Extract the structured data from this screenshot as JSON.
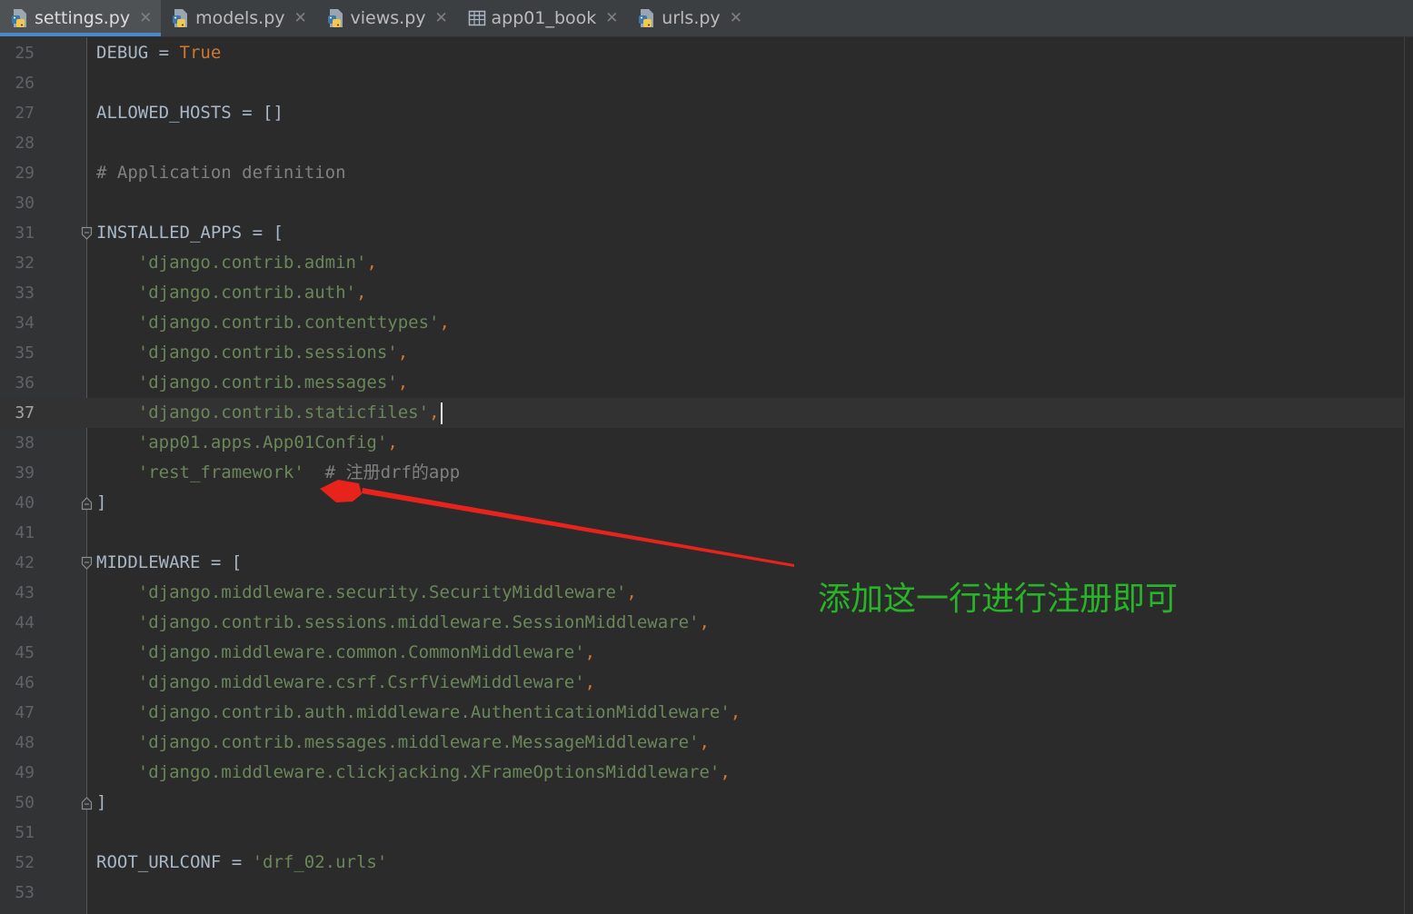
{
  "tabs": [
    {
      "label": "settings.py",
      "icon": "python-file-icon",
      "active": true
    },
    {
      "label": "models.py",
      "icon": "python-file-icon",
      "active": false
    },
    {
      "label": "views.py",
      "icon": "python-file-icon",
      "active": false
    },
    {
      "label": "app01_book",
      "icon": "table-icon",
      "active": false
    },
    {
      "label": "urls.py",
      "icon": "python-file-icon",
      "active": false
    }
  ],
  "tab_close_glyph": "✕",
  "current_line": "37",
  "lines": [
    {
      "n": "25",
      "parts": [
        {
          "t": "DEBUG = ",
          "c": "plain"
        },
        {
          "t": "True",
          "c": "kw"
        }
      ]
    },
    {
      "n": "26",
      "parts": []
    },
    {
      "n": "27",
      "parts": [
        {
          "t": "ALLOWED_HOSTS = []",
          "c": "plain"
        }
      ]
    },
    {
      "n": "28",
      "parts": []
    },
    {
      "n": "29",
      "parts": [
        {
          "t": "# Application definition",
          "c": "cmt"
        }
      ]
    },
    {
      "n": "30",
      "parts": []
    },
    {
      "n": "31",
      "parts": [
        {
          "t": "INSTALLED_APPS = [",
          "c": "plain"
        }
      ],
      "fold": "open"
    },
    {
      "n": "32",
      "parts": [
        {
          "t": "    ",
          "c": "plain"
        },
        {
          "t": "'django.contrib.admin'",
          "c": "str"
        },
        {
          "t": ",",
          "c": "kw"
        }
      ]
    },
    {
      "n": "33",
      "parts": [
        {
          "t": "    ",
          "c": "plain"
        },
        {
          "t": "'django.contrib.auth'",
          "c": "str"
        },
        {
          "t": ",",
          "c": "kw"
        }
      ]
    },
    {
      "n": "34",
      "parts": [
        {
          "t": "    ",
          "c": "plain"
        },
        {
          "t": "'django.contrib.contenttypes'",
          "c": "str"
        },
        {
          "t": ",",
          "c": "kw"
        }
      ]
    },
    {
      "n": "35",
      "parts": [
        {
          "t": "    ",
          "c": "plain"
        },
        {
          "t": "'django.contrib.sessions'",
          "c": "str"
        },
        {
          "t": ",",
          "c": "kw"
        }
      ]
    },
    {
      "n": "36",
      "parts": [
        {
          "t": "    ",
          "c": "plain"
        },
        {
          "t": "'django.contrib.messages'",
          "c": "str"
        },
        {
          "t": ",",
          "c": "kw"
        }
      ]
    },
    {
      "n": "37",
      "parts": [
        {
          "t": "    ",
          "c": "plain"
        },
        {
          "t": "'django.contrib.staticfiles'",
          "c": "str"
        },
        {
          "t": ",",
          "c": "kw"
        }
      ],
      "caret": true
    },
    {
      "n": "38",
      "parts": [
        {
          "t": "    ",
          "c": "plain"
        },
        {
          "t": "'app01.apps.App01Config'",
          "c": "str"
        },
        {
          "t": ",",
          "c": "kw"
        }
      ]
    },
    {
      "n": "39",
      "parts": [
        {
          "t": "    ",
          "c": "plain"
        },
        {
          "t": "'rest_framework'",
          "c": "str"
        },
        {
          "t": "  # ",
          "c": "cmt"
        },
        {
          "t": "注册",
          "c": "cmt-cn"
        },
        {
          "t": "drf",
          "c": "cmt"
        },
        {
          "t": "的",
          "c": "cmt-cn"
        },
        {
          "t": "app",
          "c": "cmt"
        }
      ]
    },
    {
      "n": "40",
      "parts": [
        {
          "t": "]",
          "c": "plain"
        }
      ],
      "fold": "close"
    },
    {
      "n": "41",
      "parts": []
    },
    {
      "n": "42",
      "parts": [
        {
          "t": "MIDDLEWARE = [",
          "c": "plain"
        }
      ],
      "fold": "open"
    },
    {
      "n": "43",
      "parts": [
        {
          "t": "    ",
          "c": "plain"
        },
        {
          "t": "'django.middleware.security.SecurityMiddleware'",
          "c": "str"
        },
        {
          "t": ",",
          "c": "kw"
        }
      ]
    },
    {
      "n": "44",
      "parts": [
        {
          "t": "    ",
          "c": "plain"
        },
        {
          "t": "'django.contrib.sessions.middleware.SessionMiddleware'",
          "c": "str"
        },
        {
          "t": ",",
          "c": "kw"
        }
      ]
    },
    {
      "n": "45",
      "parts": [
        {
          "t": "    ",
          "c": "plain"
        },
        {
          "t": "'django.middleware.common.CommonMiddleware'",
          "c": "str"
        },
        {
          "t": ",",
          "c": "kw"
        }
      ]
    },
    {
      "n": "46",
      "parts": [
        {
          "t": "    ",
          "c": "plain"
        },
        {
          "t": "'django.middleware.csrf.CsrfViewMiddleware'",
          "c": "str"
        },
        {
          "t": ",",
          "c": "kw"
        }
      ]
    },
    {
      "n": "47",
      "parts": [
        {
          "t": "    ",
          "c": "plain"
        },
        {
          "t": "'django.contrib.auth.middleware.AuthenticationMiddleware'",
          "c": "str"
        },
        {
          "t": ",",
          "c": "kw"
        }
      ]
    },
    {
      "n": "48",
      "parts": [
        {
          "t": "    ",
          "c": "plain"
        },
        {
          "t": "'django.contrib.messages.middleware.MessageMiddleware'",
          "c": "str"
        },
        {
          "t": ",",
          "c": "kw"
        }
      ]
    },
    {
      "n": "49",
      "parts": [
        {
          "t": "    ",
          "c": "plain"
        },
        {
          "t": "'django.middleware.clickjacking.XFrameOptionsMiddleware'",
          "c": "str"
        },
        {
          "t": ",",
          "c": "kw"
        }
      ]
    },
    {
      "n": "50",
      "parts": [
        {
          "t": "]",
          "c": "plain"
        }
      ],
      "fold": "close"
    },
    {
      "n": "51",
      "parts": []
    },
    {
      "n": "52",
      "parts": [
        {
          "t": "ROOT_URLCONF = ",
          "c": "plain"
        },
        {
          "t": "'drf_02.urls'",
          "c": "str"
        }
      ]
    },
    {
      "n": "53",
      "parts": []
    }
  ],
  "annotation": {
    "text": "添加这一行进行注册即可",
    "text_color": "#27b427",
    "arrow_color": "#e8231b"
  },
  "colors": {
    "background": "#2b2b2b",
    "gutter": "#313335",
    "keyword": "#cc7832",
    "string": "#6a8759",
    "comment": "#808080",
    "plain": "#a9b7c6",
    "tab_accent": "#4a88c7"
  }
}
